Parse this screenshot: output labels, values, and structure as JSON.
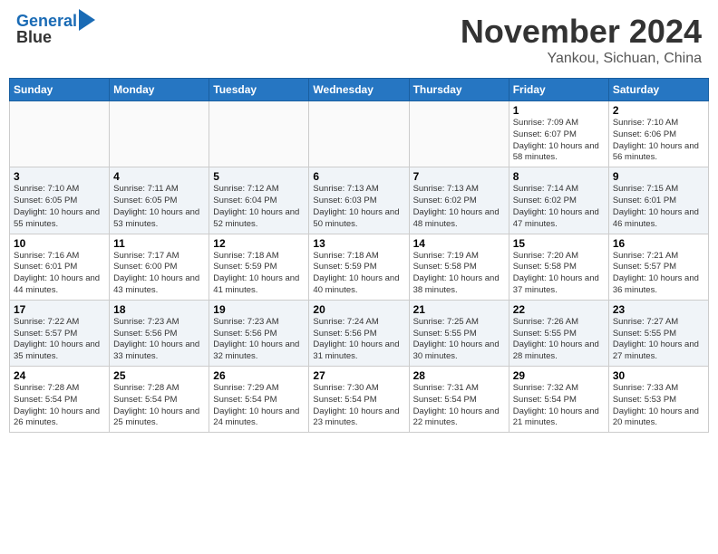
{
  "header": {
    "logo_line1": "General",
    "logo_line2": "Blue",
    "month": "November 2024",
    "location": "Yankou, Sichuan, China"
  },
  "weekdays": [
    "Sunday",
    "Monday",
    "Tuesday",
    "Wednesday",
    "Thursday",
    "Friday",
    "Saturday"
  ],
  "weeks": [
    [
      {
        "day": "",
        "info": ""
      },
      {
        "day": "",
        "info": ""
      },
      {
        "day": "",
        "info": ""
      },
      {
        "day": "",
        "info": ""
      },
      {
        "day": "",
        "info": ""
      },
      {
        "day": "1",
        "info": "Sunrise: 7:09 AM\nSunset: 6:07 PM\nDaylight: 10 hours and 58 minutes."
      },
      {
        "day": "2",
        "info": "Sunrise: 7:10 AM\nSunset: 6:06 PM\nDaylight: 10 hours and 56 minutes."
      }
    ],
    [
      {
        "day": "3",
        "info": "Sunrise: 7:10 AM\nSunset: 6:05 PM\nDaylight: 10 hours and 55 minutes."
      },
      {
        "day": "4",
        "info": "Sunrise: 7:11 AM\nSunset: 6:05 PM\nDaylight: 10 hours and 53 minutes."
      },
      {
        "day": "5",
        "info": "Sunrise: 7:12 AM\nSunset: 6:04 PM\nDaylight: 10 hours and 52 minutes."
      },
      {
        "day": "6",
        "info": "Sunrise: 7:13 AM\nSunset: 6:03 PM\nDaylight: 10 hours and 50 minutes."
      },
      {
        "day": "7",
        "info": "Sunrise: 7:13 AM\nSunset: 6:02 PM\nDaylight: 10 hours and 48 minutes."
      },
      {
        "day": "8",
        "info": "Sunrise: 7:14 AM\nSunset: 6:02 PM\nDaylight: 10 hours and 47 minutes."
      },
      {
        "day": "9",
        "info": "Sunrise: 7:15 AM\nSunset: 6:01 PM\nDaylight: 10 hours and 46 minutes."
      }
    ],
    [
      {
        "day": "10",
        "info": "Sunrise: 7:16 AM\nSunset: 6:01 PM\nDaylight: 10 hours and 44 minutes."
      },
      {
        "day": "11",
        "info": "Sunrise: 7:17 AM\nSunset: 6:00 PM\nDaylight: 10 hours and 43 minutes."
      },
      {
        "day": "12",
        "info": "Sunrise: 7:18 AM\nSunset: 5:59 PM\nDaylight: 10 hours and 41 minutes."
      },
      {
        "day": "13",
        "info": "Sunrise: 7:18 AM\nSunset: 5:59 PM\nDaylight: 10 hours and 40 minutes."
      },
      {
        "day": "14",
        "info": "Sunrise: 7:19 AM\nSunset: 5:58 PM\nDaylight: 10 hours and 38 minutes."
      },
      {
        "day": "15",
        "info": "Sunrise: 7:20 AM\nSunset: 5:58 PM\nDaylight: 10 hours and 37 minutes."
      },
      {
        "day": "16",
        "info": "Sunrise: 7:21 AM\nSunset: 5:57 PM\nDaylight: 10 hours and 36 minutes."
      }
    ],
    [
      {
        "day": "17",
        "info": "Sunrise: 7:22 AM\nSunset: 5:57 PM\nDaylight: 10 hours and 35 minutes."
      },
      {
        "day": "18",
        "info": "Sunrise: 7:23 AM\nSunset: 5:56 PM\nDaylight: 10 hours and 33 minutes."
      },
      {
        "day": "19",
        "info": "Sunrise: 7:23 AM\nSunset: 5:56 PM\nDaylight: 10 hours and 32 minutes."
      },
      {
        "day": "20",
        "info": "Sunrise: 7:24 AM\nSunset: 5:56 PM\nDaylight: 10 hours and 31 minutes."
      },
      {
        "day": "21",
        "info": "Sunrise: 7:25 AM\nSunset: 5:55 PM\nDaylight: 10 hours and 30 minutes."
      },
      {
        "day": "22",
        "info": "Sunrise: 7:26 AM\nSunset: 5:55 PM\nDaylight: 10 hours and 28 minutes."
      },
      {
        "day": "23",
        "info": "Sunrise: 7:27 AM\nSunset: 5:55 PM\nDaylight: 10 hours and 27 minutes."
      }
    ],
    [
      {
        "day": "24",
        "info": "Sunrise: 7:28 AM\nSunset: 5:54 PM\nDaylight: 10 hours and 26 minutes."
      },
      {
        "day": "25",
        "info": "Sunrise: 7:28 AM\nSunset: 5:54 PM\nDaylight: 10 hours and 25 minutes."
      },
      {
        "day": "26",
        "info": "Sunrise: 7:29 AM\nSunset: 5:54 PM\nDaylight: 10 hours and 24 minutes."
      },
      {
        "day": "27",
        "info": "Sunrise: 7:30 AM\nSunset: 5:54 PM\nDaylight: 10 hours and 23 minutes."
      },
      {
        "day": "28",
        "info": "Sunrise: 7:31 AM\nSunset: 5:54 PM\nDaylight: 10 hours and 22 minutes."
      },
      {
        "day": "29",
        "info": "Sunrise: 7:32 AM\nSunset: 5:54 PM\nDaylight: 10 hours and 21 minutes."
      },
      {
        "day": "30",
        "info": "Sunrise: 7:33 AM\nSunset: 5:53 PM\nDaylight: 10 hours and 20 minutes."
      }
    ]
  ]
}
